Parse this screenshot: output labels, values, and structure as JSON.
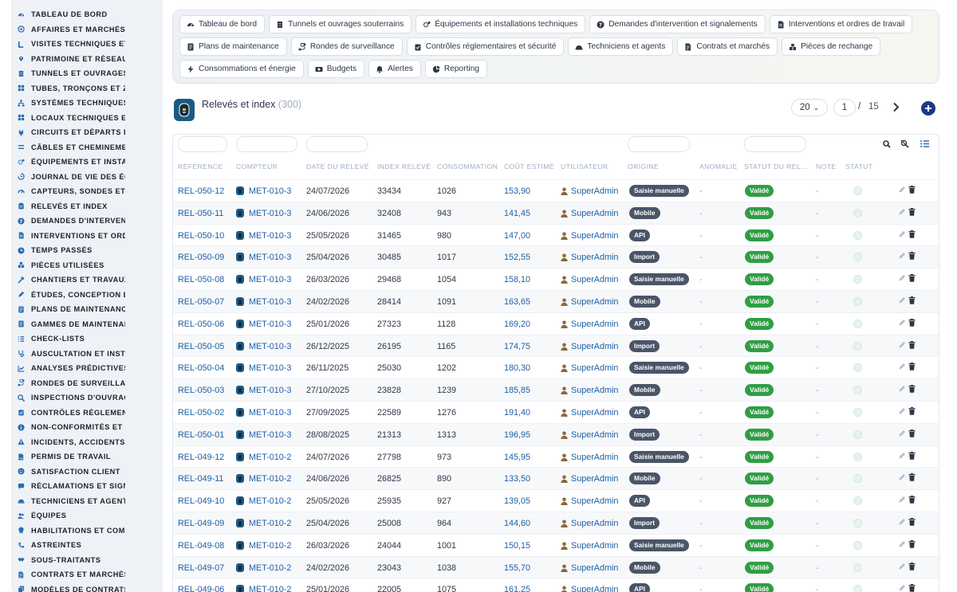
{
  "sidebar": {
    "items": [
      {
        "label": "TABLEAU DE BORD",
        "icon": "dashboard-icon"
      },
      {
        "label": "AFFAIRES ET MARCHÉS",
        "icon": "target-icon"
      },
      {
        "label": "VISITES TECHNIQUES ET",
        "icon": "visit-icon"
      },
      {
        "label": "PATRIMOINE ET RÉSEAUX",
        "icon": "map-pin-icon"
      },
      {
        "label": "TUNNELS ET OUVRAGES",
        "icon": "building-icon"
      },
      {
        "label": "TUBES, TRONÇONS ET ZO",
        "icon": "grid-icon"
      },
      {
        "label": "SYSTÈMES TECHNIQUES",
        "icon": "sitemap-icon"
      },
      {
        "label": "LOCAUX TECHNIQUES ET",
        "icon": "grid-icon"
      },
      {
        "label": "CIRCUITS ET DÉPARTS ÉL",
        "icon": "plug-icon"
      },
      {
        "label": "CÂBLES ET CHEMINEMEN",
        "icon": "cable-icon"
      },
      {
        "label": "ÉQUIPEMENTS ET INSTAL",
        "icon": "gears-icon"
      },
      {
        "label": "JOURNAL DE VIE DES ÉQ",
        "icon": "book-icon"
      },
      {
        "label": "CAPTEURS, SONDES ET C",
        "icon": "gauge-icon"
      },
      {
        "label": "RELEVÉS ET INDEX",
        "icon": "clipboard-icon"
      },
      {
        "label": "DEMANDES D'INTERVENT",
        "icon": "question-icon"
      },
      {
        "label": "INTERVENTIONS ET ORDI",
        "icon": "document-icon"
      },
      {
        "label": "TEMPS PASSÉS",
        "icon": "clock-icon"
      },
      {
        "label": "PIÈCES UTILISÉES",
        "icon": "parts-icon"
      },
      {
        "label": "CHANTIERS ET TRAVAUX",
        "icon": "hammer-icon"
      },
      {
        "label": "ÉTUDES, CONCEPTION ET",
        "icon": "pencil-icon"
      },
      {
        "label": "PLANS DE MAINTENANCE",
        "icon": "list-icon"
      },
      {
        "label": "GAMMES DE MAINTENAN",
        "icon": "list-icon"
      },
      {
        "label": "CHECK-LISTS",
        "icon": "checklist-icon"
      },
      {
        "label": "AUSCULTATION ET INSTR",
        "icon": "stethoscope-icon"
      },
      {
        "label": "ANALYSES PRÉDICTIVES",
        "icon": "chart-icon"
      },
      {
        "label": "RONDES DE SURVEILLAN",
        "icon": "route-icon"
      },
      {
        "label": "INSPECTIONS D'OUVRAG",
        "icon": "search-icon"
      },
      {
        "label": "CONTRÔLES RÉGLEMENT",
        "icon": "clipboard-check-icon"
      },
      {
        "label": "NON-CONFORMITÉS ET A",
        "icon": "info-icon"
      },
      {
        "label": "INCIDENTS, ACCIDENTS E",
        "icon": "warning-icon"
      },
      {
        "label": "PERMIS DE TRAVAIL",
        "icon": "file-signature-icon"
      },
      {
        "label": "SATISFACTION CLIENT",
        "icon": "smile-icon"
      },
      {
        "label": "RÉCLAMATIONS ET SIGNA",
        "icon": "comment-icon"
      },
      {
        "label": "TECHNICIENS ET AGENTS",
        "icon": "helmet-icon"
      },
      {
        "label": "ÉQUIPES",
        "icon": "users-icon"
      },
      {
        "label": "HABILITATIONS ET COMP",
        "icon": "certificate-icon"
      },
      {
        "label": "ASTREINTES",
        "icon": "phone-icon"
      },
      {
        "label": "SOUS-TRAITANTS",
        "icon": "handshake-icon"
      },
      {
        "label": "CONTRATS ET MARCHÉS",
        "icon": "contract-icon"
      },
      {
        "label": "MODÈLES DE CONTRATS",
        "icon": "copy-icon"
      }
    ]
  },
  "topnav": {
    "rows": [
      [
        {
          "label": "Tableau de bord",
          "icon": "dashboard-icon"
        },
        {
          "label": "Tunnels et ouvrages souterrains",
          "icon": "building-icon"
        },
        {
          "label": "Équipements et installations techniques",
          "icon": "gears-icon"
        },
        {
          "label": "Demandes d'intervention et signalements",
          "icon": "question-icon"
        },
        {
          "label": "Interventions et ordres de travail",
          "icon": "document-icon"
        }
      ],
      [
        {
          "label": "Plans de maintenance",
          "icon": "list-icon"
        },
        {
          "label": "Rondes de surveillance",
          "icon": "route-icon"
        },
        {
          "label": "Contrôles réglementaires et sécurité",
          "icon": "clipboard-check-icon"
        },
        {
          "label": "Techniciens et agents",
          "icon": "helmet-icon"
        },
        {
          "label": "Contrats et marchés",
          "icon": "contract-icon"
        },
        {
          "label": "Pièces de rechange",
          "icon": "parts-icon"
        }
      ],
      [
        {
          "label": "Consommations et énergie",
          "icon": "bolt-icon"
        },
        {
          "label": "Budgets",
          "icon": "money-icon"
        },
        {
          "label": "Alertes",
          "icon": "bell-icon"
        },
        {
          "label": "Reporting",
          "icon": "pie-icon"
        }
      ]
    ]
  },
  "header": {
    "title": "Relevés et index",
    "count": "(300)",
    "page_size": "20",
    "page": "1",
    "page_sep": "/",
    "total_pages": "15"
  },
  "table": {
    "columns": [
      "RÉFÉRENCE",
      "COMPTEUR",
      "DATE DU RELEVÉ",
      "INDEX RELEVÉ",
      "CONSOMMATION",
      "COÛT ESTIMÉ",
      "UTILISATEUR",
      "ORIGINE",
      "ANOMALIE",
      "STATUT DU REL...",
      "NOTE",
      "STATUT"
    ],
    "rows": [
      {
        "ref": "REL-050-12",
        "meter": "MET-010-3",
        "date": "24/07/2026",
        "index": "33434",
        "conso": "1026",
        "cost": "153,90",
        "user": "SuperAdmin",
        "origin": "Saisie manuelle",
        "anomaly": "-",
        "status": "Validé",
        "note": "-"
      },
      {
        "ref": "REL-050-11",
        "meter": "MET-010-3",
        "date": "24/06/2026",
        "index": "32408",
        "conso": "943",
        "cost": "141,45",
        "user": "SuperAdmin",
        "origin": "Mobile",
        "anomaly": "-",
        "status": "Validé",
        "note": "-"
      },
      {
        "ref": "REL-050-10",
        "meter": "MET-010-3",
        "date": "25/05/2026",
        "index": "31465",
        "conso": "980",
        "cost": "147,00",
        "user": "SuperAdmin",
        "origin": "API",
        "anomaly": "-",
        "status": "Validé",
        "note": "-"
      },
      {
        "ref": "REL-050-09",
        "meter": "MET-010-3",
        "date": "25/04/2026",
        "index": "30485",
        "conso": "1017",
        "cost": "152,55",
        "user": "SuperAdmin",
        "origin": "Import",
        "anomaly": "-",
        "status": "Validé",
        "note": "-"
      },
      {
        "ref": "REL-050-08",
        "meter": "MET-010-3",
        "date": "26/03/2026",
        "index": "29468",
        "conso": "1054",
        "cost": "158,10",
        "user": "SuperAdmin",
        "origin": "Saisie manuelle",
        "anomaly": "-",
        "status": "Validé",
        "note": "-"
      },
      {
        "ref": "REL-050-07",
        "meter": "MET-010-3",
        "date": "24/02/2026",
        "index": "28414",
        "conso": "1091",
        "cost": "163,65",
        "user": "SuperAdmin",
        "origin": "Mobile",
        "anomaly": "-",
        "status": "Validé",
        "note": "-"
      },
      {
        "ref": "REL-050-06",
        "meter": "MET-010-3",
        "date": "25/01/2026",
        "index": "27323",
        "conso": "1128",
        "cost": "169,20",
        "user": "SuperAdmin",
        "origin": "API",
        "anomaly": "-",
        "status": "Validé",
        "note": "-"
      },
      {
        "ref": "REL-050-05",
        "meter": "MET-010-3",
        "date": "26/12/2025",
        "index": "26195",
        "conso": "1165",
        "cost": "174,75",
        "user": "SuperAdmin",
        "origin": "Import",
        "anomaly": "-",
        "status": "Validé",
        "note": "-"
      },
      {
        "ref": "REL-050-04",
        "meter": "MET-010-3",
        "date": "26/11/2025",
        "index": "25030",
        "conso": "1202",
        "cost": "180,30",
        "user": "SuperAdmin",
        "origin": "Saisie manuelle",
        "anomaly": "-",
        "status": "Validé",
        "note": "-"
      },
      {
        "ref": "REL-050-03",
        "meter": "MET-010-3",
        "date": "27/10/2025",
        "index": "23828",
        "conso": "1239",
        "cost": "185,85",
        "user": "SuperAdmin",
        "origin": "Mobile",
        "anomaly": "-",
        "status": "Validé",
        "note": "-"
      },
      {
        "ref": "REL-050-02",
        "meter": "MET-010-3",
        "date": "27/09/2025",
        "index": "22589",
        "conso": "1276",
        "cost": "191,40",
        "user": "SuperAdmin",
        "origin": "API",
        "anomaly": "-",
        "status": "Validé",
        "note": "-"
      },
      {
        "ref": "REL-050-01",
        "meter": "MET-010-3",
        "date": "28/08/2025",
        "index": "21313",
        "conso": "1313",
        "cost": "196,95",
        "user": "SuperAdmin",
        "origin": "Import",
        "anomaly": "-",
        "status": "Validé",
        "note": "-"
      },
      {
        "ref": "REL-049-12",
        "meter": "MET-010-2",
        "date": "24/07/2026",
        "index": "27798",
        "conso": "973",
        "cost": "145,95",
        "user": "SuperAdmin",
        "origin": "Saisie manuelle",
        "anomaly": "-",
        "status": "Validé",
        "note": "-"
      },
      {
        "ref": "REL-049-11",
        "meter": "MET-010-2",
        "date": "24/06/2026",
        "index": "26825",
        "conso": "890",
        "cost": "133,50",
        "user": "SuperAdmin",
        "origin": "Mobile",
        "anomaly": "-",
        "status": "Validé",
        "note": "-"
      },
      {
        "ref": "REL-049-10",
        "meter": "MET-010-2",
        "date": "25/05/2026",
        "index": "25935",
        "conso": "927",
        "cost": "139,05",
        "user": "SuperAdmin",
        "origin": "API",
        "anomaly": "-",
        "status": "Validé",
        "note": "-"
      },
      {
        "ref": "REL-049-09",
        "meter": "MET-010-2",
        "date": "25/04/2026",
        "index": "25008",
        "conso": "964",
        "cost": "144,60",
        "user": "SuperAdmin",
        "origin": "Import",
        "anomaly": "-",
        "status": "Validé",
        "note": "-"
      },
      {
        "ref": "REL-049-08",
        "meter": "MET-010-2",
        "date": "26/03/2026",
        "index": "24044",
        "conso": "1001",
        "cost": "150,15",
        "user": "SuperAdmin",
        "origin": "Saisie manuelle",
        "anomaly": "-",
        "status": "Validé",
        "note": "-"
      },
      {
        "ref": "REL-049-07",
        "meter": "MET-010-2",
        "date": "24/02/2026",
        "index": "23043",
        "conso": "1038",
        "cost": "155,70",
        "user": "SuperAdmin",
        "origin": "Mobile",
        "anomaly": "-",
        "status": "Validé",
        "note": "-"
      },
      {
        "ref": "REL-049-06",
        "meter": "MET-010-2",
        "date": "25/01/2026",
        "index": "22005",
        "conso": "1075",
        "cost": "161,25",
        "user": "SuperAdmin",
        "origin": "API",
        "anomaly": "-",
        "status": "Validé",
        "note": "-"
      }
    ]
  },
  "colors": {
    "accent": "#1a3a86",
    "link": "#1f5fa6",
    "badge_green": "#2f9e44",
    "badge_gray": "#4a5568",
    "sidebar_bg": "#eef2f6"
  }
}
